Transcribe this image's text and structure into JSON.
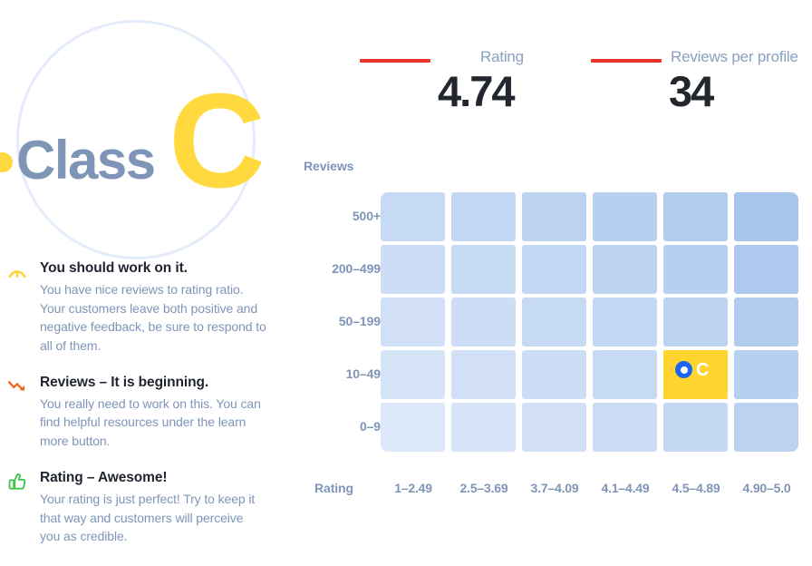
{
  "hero": {
    "class_word": "Class",
    "grade_letter": "C",
    "dot_color": "#ffd93d",
    "circle_color": "#e4ecfb",
    "word_color": "#7e95b8"
  },
  "metrics": [
    {
      "id": "rating",
      "label": "Rating",
      "value": "4.74",
      "rule_color": "#e8352b"
    },
    {
      "id": "reviews-per-profile",
      "label": "Reviews per profile",
      "value": "34",
      "rule_color": "#e8352b"
    }
  ],
  "feedback": [
    {
      "icon": "gauge-icon",
      "icon_color": "#ffd42e",
      "title": "You should work on it.",
      "body": "You have nice reviews to rating ratio. Your customers leave both positive and negative feedback, be sure to respond to all of them."
    },
    {
      "icon": "trend-down-icon",
      "icon_color": "#f4671f",
      "title": "Reviews – It is beginning.",
      "body": "You really need to work on this. You can find helpful resources under the learn more button."
    },
    {
      "icon": "thumbs-up-icon",
      "icon_color": "#3fc34a",
      "title": "Rating – Awesome!",
      "body": "Your rating is just perfect! Try to keep it that way and customers will perceive you as credible."
    }
  ],
  "chart_data": {
    "type": "heatmap",
    "title": "",
    "ylabel": "Reviews",
    "xlabel": "Rating",
    "y_categories": [
      "500+",
      "200–499",
      "50–199",
      "10–49",
      "0–9"
    ],
    "x_categories": [
      "1–2.49",
      "2.5–3.69",
      "3.7–4.09",
      "4.1–4.49",
      "4.5–4.89",
      "4.90–5.0"
    ],
    "grid": true,
    "legend": "none",
    "values": [
      [
        0.5,
        0.58,
        0.66,
        0.74,
        0.84,
        1.0
      ],
      [
        0.42,
        0.5,
        0.58,
        0.66,
        0.76,
        0.92
      ],
      [
        0.34,
        0.42,
        0.5,
        0.58,
        0.68,
        0.84
      ],
      [
        0.26,
        0.34,
        0.42,
        0.5,
        0.6,
        0.76
      ],
      [
        0.16,
        0.24,
        0.34,
        0.44,
        0.54,
        0.7
      ]
    ],
    "cell_color_low": "#e6eefc",
    "cell_color_high": "#a8c6ec",
    "highlight": {
      "row": "10–49",
      "column": "4.5–4.89",
      "row_index": 3,
      "col_index": 4,
      "color": "#ffd42e",
      "marker_label": "C",
      "marker_color": "#1a66f0"
    }
  }
}
